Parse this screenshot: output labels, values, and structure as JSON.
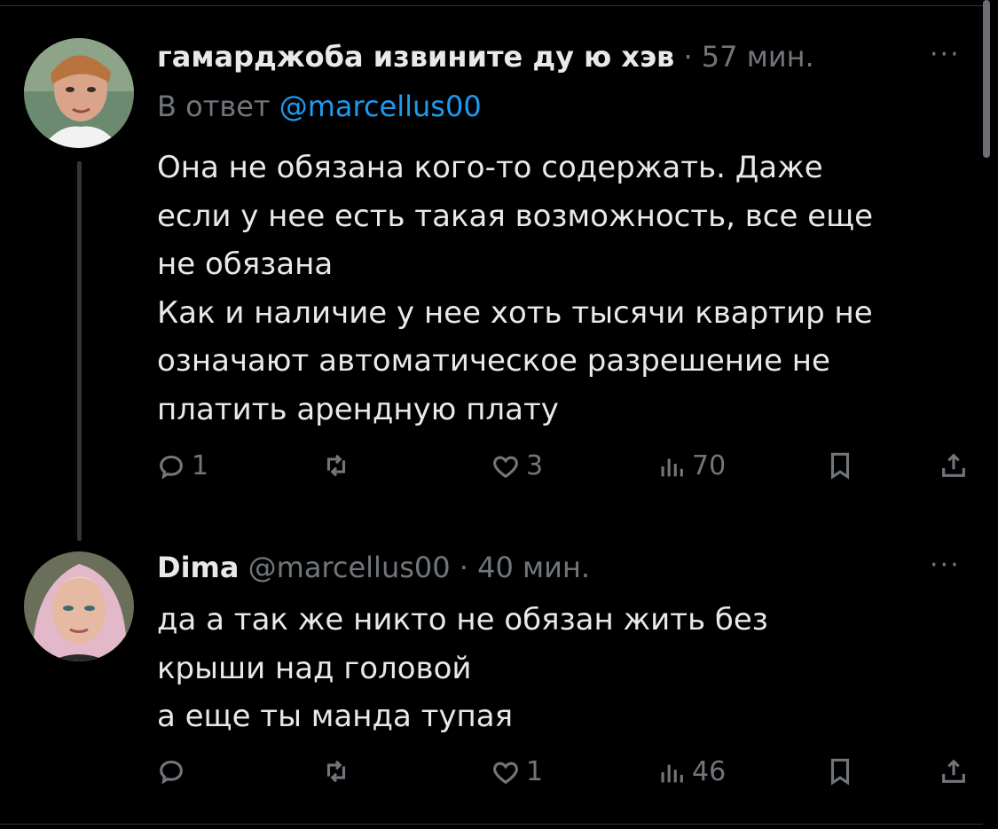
{
  "tweets": [
    {
      "author_name": "гамарджоба извините ду ю хэв",
      "separator": "·",
      "time": "57 мин.",
      "reply_prefix": "В ответ",
      "reply_to": "@marcellus00",
      "body": "Она не обязана кого-то содержать. Даже\nесли у нее есть такая возможность, все еще\nне обязана\nКак и наличие у нее хоть тысячи квартир не\nозначают автоматическое разрешение не\nплатить арендную плату",
      "more_label": "···",
      "actions": {
        "reply_count": "1",
        "retweet_count": "",
        "like_count": "3",
        "views_count": "70"
      }
    },
    {
      "author_name": "Dima",
      "handle": "@marcellus00",
      "separator": "·",
      "time": "40 мин.",
      "body": "да а так же никто не обязан жить без\nкрыши над головой\nа еще ты манда тупая",
      "more_label": "···",
      "actions": {
        "reply_count": "",
        "retweet_count": "",
        "like_count": "1",
        "views_count": "46"
      }
    }
  ],
  "icons": {
    "reply": "reply-icon",
    "retweet": "retweet-icon",
    "like": "heart-icon",
    "views": "views-icon",
    "bookmark": "bookmark-icon",
    "share": "share-icon"
  }
}
